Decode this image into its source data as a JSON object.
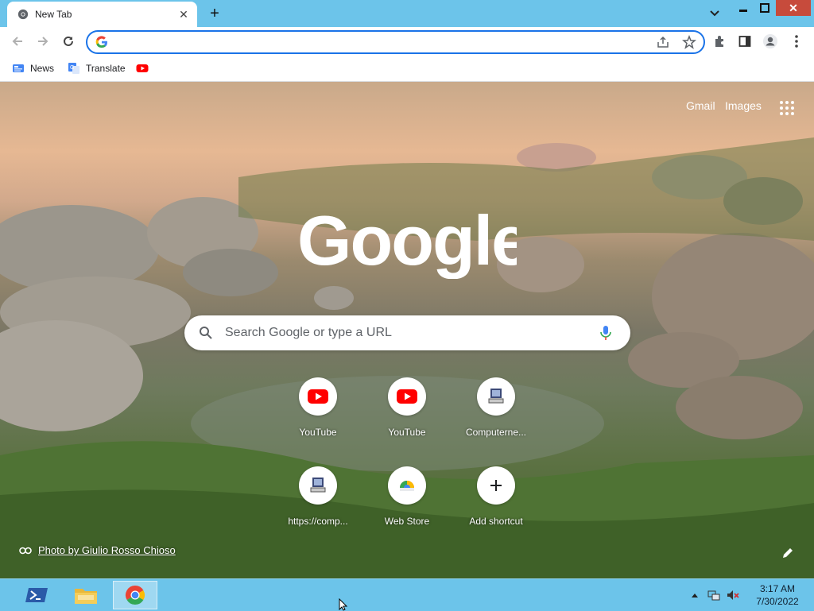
{
  "browser": {
    "tab_title": "New Tab",
    "omnibox_value": "",
    "accent_color": "#1a73e8",
    "titlebar_color": "#6cc4ea"
  },
  "bookmarks": [
    {
      "label": "News",
      "icon": "google-news-icon"
    },
    {
      "label": "Translate",
      "icon": "google-translate-icon"
    },
    {
      "label": "",
      "icon": "youtube-icon"
    }
  ],
  "ntp": {
    "top_links": {
      "gmail": "Gmail",
      "images": "Images"
    },
    "search_placeholder": "Search Google or type a URL",
    "shortcuts": [
      {
        "label": "YouTube",
        "icon": "youtube-icon"
      },
      {
        "label": "YouTube",
        "icon": "youtube-icon"
      },
      {
        "label": "Computerne...",
        "icon": "computer-icon"
      },
      {
        "label": "https://comp...",
        "icon": "computer-icon"
      },
      {
        "label": "Web Store",
        "icon": "chrome-web-store-icon"
      },
      {
        "label": "Add shortcut",
        "icon": "plus-icon"
      }
    ],
    "photo_credit": "Photo by Giulio Rosso Chioso"
  },
  "taskbar": {
    "apps": [
      "powershell-icon",
      "file-explorer-icon",
      "chrome-icon"
    ],
    "time": "3:17 AM",
    "date": "7/30/2022"
  }
}
